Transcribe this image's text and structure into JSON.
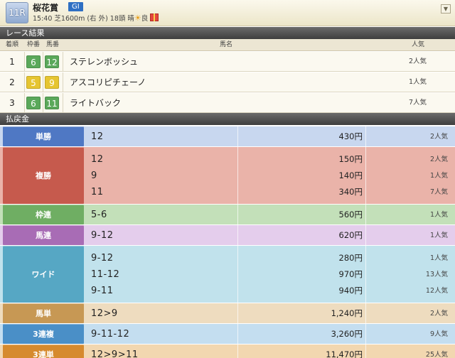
{
  "header": {
    "race_number": "11R",
    "race_name": "桜花賞",
    "grade": "GI",
    "info": "15:40 芝1600m (右 外) 18頭 晴",
    "condition": "良",
    "weather_icon": "sun-icon",
    "gift_icon": "gift-icon",
    "toggle_icon": "chevron-down-icon"
  },
  "results": {
    "section_title": "レース結果",
    "columns": {
      "rank": "着順",
      "waku": "枠番",
      "umaban": "馬番",
      "horse": "馬名",
      "popularity": "人気"
    },
    "rows": [
      {
        "rank": "1",
        "waku": "6",
        "umaban": "12",
        "horse": "ステレンボッシュ",
        "popularity": "2人気",
        "waku_color": "#5aa85a"
      },
      {
        "rank": "2",
        "waku": "5",
        "umaban": "9",
        "horse": "アスコリピチェーノ",
        "popularity": "1人気",
        "waku_color": "#e6c531"
      },
      {
        "rank": "3",
        "waku": "6",
        "umaban": "11",
        "horse": "ライトバック",
        "popularity": "7人気",
        "waku_color": "#5aa85a"
      }
    ]
  },
  "payouts": {
    "section_title": "払戻金",
    "rows": [
      {
        "label": "単勝",
        "label_color": "#4f78c4",
        "bg": "#c8d7ef",
        "lines": [
          {
            "combo": "12",
            "yen": "430円",
            "pop": "2人気"
          }
        ]
      },
      {
        "label": "複勝",
        "label_color": "#c65a4d",
        "bg": "#eab3a9",
        "lines": [
          {
            "combo": "12",
            "yen": "150円",
            "pop": "2人気"
          },
          {
            "combo": "9",
            "yen": "140円",
            "pop": "1人気"
          },
          {
            "combo": "11",
            "yen": "340円",
            "pop": "7人気"
          }
        ]
      },
      {
        "label": "枠連",
        "label_color": "#6fae63",
        "bg": "#c3e0b9",
        "lines": [
          {
            "combo": "5-6",
            "yen": "560円",
            "pop": "1人気"
          }
        ]
      },
      {
        "label": "馬連",
        "label_color": "#a86cb5",
        "bg": "#e4cdec",
        "lines": [
          {
            "combo": "9-12",
            "yen": "620円",
            "pop": "1人気"
          }
        ]
      },
      {
        "label": "ワイド",
        "label_color": "#56a7c4",
        "bg": "#c1e2ec",
        "lines": [
          {
            "combo": "9-12",
            "yen": "280円",
            "pop": "1人気"
          },
          {
            "combo": "11-12",
            "yen": "970円",
            "pop": "13人気"
          },
          {
            "combo": "9-11",
            "yen": "940円",
            "pop": "12人気"
          }
        ]
      },
      {
        "label": "馬単",
        "label_color": "#c79854",
        "bg": "#eedcbf",
        "lines": [
          {
            "combo": "12>9",
            "yen": "1,240円",
            "pop": "2人気"
          }
        ]
      },
      {
        "label": "3連複",
        "label_color": "#4a8fc7",
        "bg": "#c4def0",
        "lines": [
          {
            "combo": "9-11-12",
            "yen": "3,260円",
            "pop": "9人気"
          }
        ]
      },
      {
        "label": "3連単",
        "label_color": "#d68a2e",
        "bg": "#f2d7b0",
        "lines": [
          {
            "combo": "12>9>11",
            "yen": "11,470円",
            "pop": "25人気"
          }
        ]
      }
    ]
  }
}
